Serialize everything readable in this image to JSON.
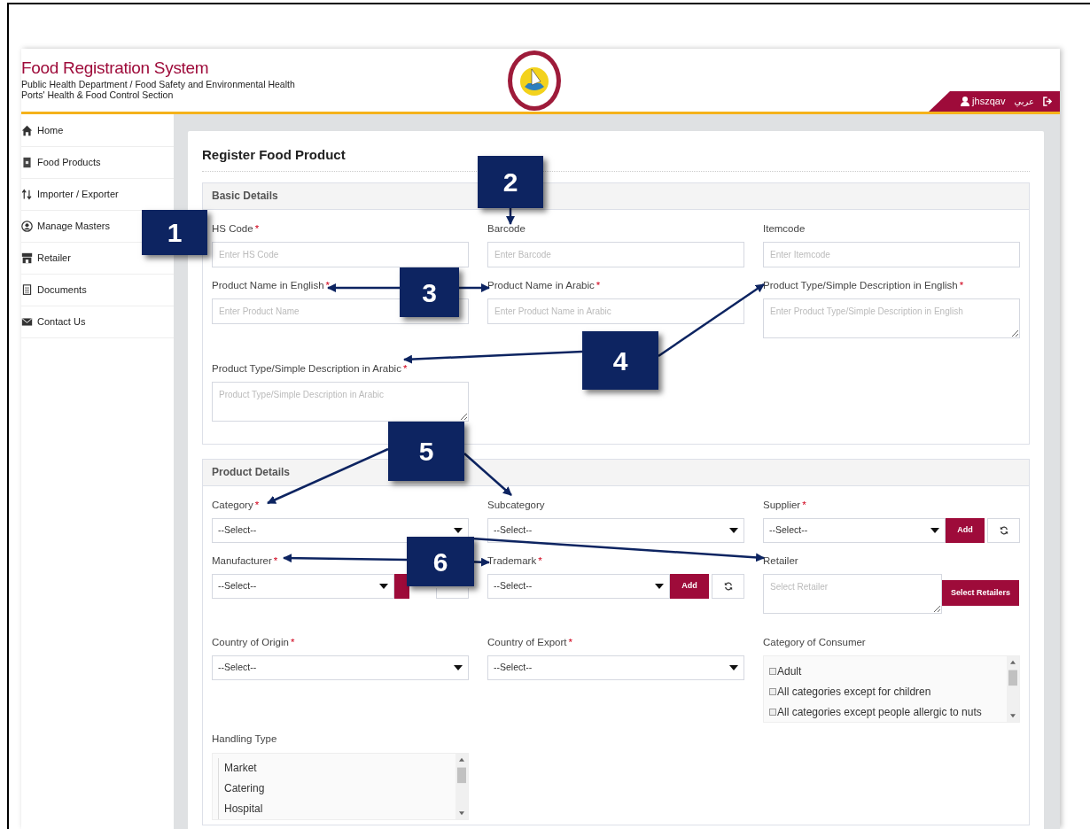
{
  "header": {
    "title": "Food Registration System",
    "subtitle_lines": [
      "Public Health Department / Food Safety and Environmental Health",
      "Ports' Health & Food Control Section"
    ],
    "username": "jhszqav",
    "language_link": "عربي"
  },
  "sidebar": {
    "items": [
      {
        "label": "Home"
      },
      {
        "label": "Food Products"
      },
      {
        "label": "Importer / Exporter"
      },
      {
        "label": "Manage Masters"
      },
      {
        "label": "Retailer"
      },
      {
        "label": "Documents"
      },
      {
        "label": "Contact Us"
      }
    ]
  },
  "page_title": "Register Food Product",
  "sections": [
    {
      "title": "Basic Details",
      "rows": [
        [
          {
            "kind": "input",
            "label": "HS Code",
            "required": true,
            "placeholder": "Enter HS Code"
          },
          {
            "kind": "input",
            "label": "Barcode",
            "placeholder": "Enter Barcode"
          },
          {
            "kind": "input",
            "label": "Itemcode",
            "placeholder": "Enter Itemcode"
          }
        ],
        [
          {
            "kind": "input",
            "label": "Product Name in English",
            "required": true,
            "placeholder": "Enter Product Name"
          },
          {
            "kind": "input",
            "label": "Product Name in Arabic",
            "required": true,
            "placeholder": "Enter Product Name in Arabic"
          },
          {
            "kind": "textarea",
            "label": "Product Type/Simple Description in English",
            "required": true,
            "placeholder": "Enter Product Type/Simple Description in English"
          }
        ],
        [
          {
            "kind": "textarea",
            "label": "Product Type/Simple Description in Arabic",
            "required": true,
            "placeholder": "Product Type/Simple Description in Arabic"
          }
        ]
      ]
    },
    {
      "title": "Product Details",
      "rows": [
        [
          {
            "kind": "select",
            "label": "Category",
            "required": true,
            "value": "--Select--"
          },
          {
            "kind": "select",
            "label": "Subcategory",
            "value": "--Select--"
          },
          {
            "kind": "select-add",
            "label": "Supplier",
            "required": true,
            "value": "--Select--",
            "add_label": "Add"
          }
        ],
        [
          {
            "kind": "select-add",
            "label": "Manufacturer",
            "required": true,
            "value": "--Select--"
          },
          {
            "kind": "select-add",
            "label": "Trademark",
            "required": true,
            "value": "--Select--",
            "add_label": "Add"
          },
          {
            "kind": "retailer",
            "label": "Retailer",
            "placeholder": "Select Retailer",
            "button": "Select Retailers"
          }
        ],
        [
          {
            "kind": "select",
            "label": "Country of Origin",
            "required": true,
            "value": "--Select--"
          },
          {
            "kind": "select",
            "label": "Country of Export",
            "required": true,
            "value": "--Select--"
          },
          {
            "kind": "checklist",
            "label": "Category of Consumer",
            "options": [
              {
                "label": "Adult",
                "checked": false
              },
              {
                "label": "All categories except for children",
                "checked": false
              },
              {
                "label": "All categories except people allergic to nuts",
                "checked": false
              }
            ]
          }
        ],
        [
          {
            "kind": "list",
            "label": "Handling Type",
            "options": [
              "Market",
              "Catering",
              "Hospital"
            ]
          }
        ]
      ]
    }
  ],
  "callouts": [
    {
      "label": "1"
    },
    {
      "label": "2"
    },
    {
      "label": "3"
    },
    {
      "label": "4"
    },
    {
      "label": "5"
    },
    {
      "label": "6"
    }
  ],
  "required_mark": "*"
}
